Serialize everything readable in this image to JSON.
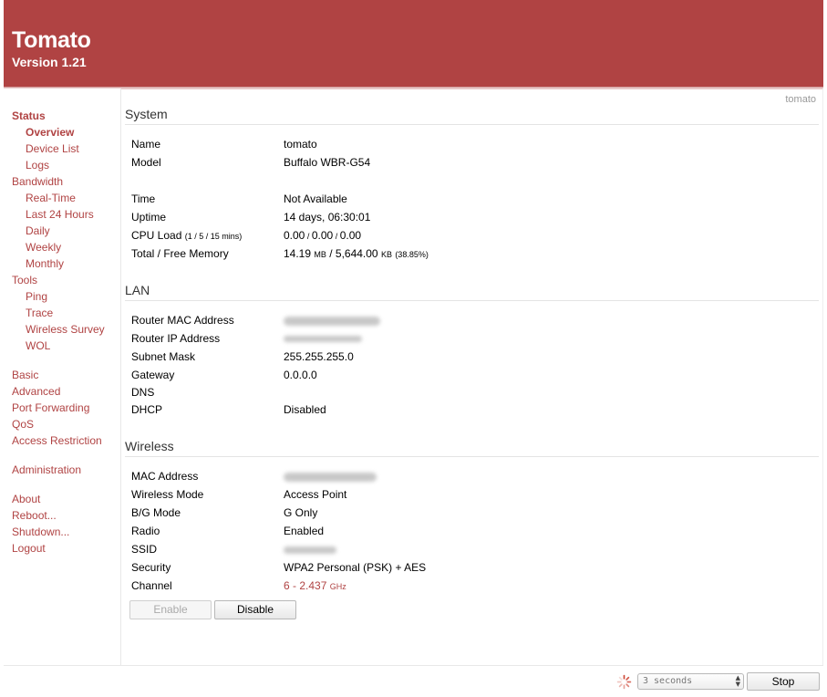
{
  "app": {
    "title": "Tomato",
    "version": "Version 1.21",
    "hostname": "tomato"
  },
  "nav": {
    "status": "Status",
    "overview": "Overview",
    "device_list": "Device List",
    "logs": "Logs",
    "bandwidth": "Bandwidth",
    "real_time": "Real-Time",
    "last24": "Last 24 Hours",
    "daily": "Daily",
    "weekly": "Weekly",
    "monthly": "Monthly",
    "tools": "Tools",
    "ping": "Ping",
    "trace": "Trace",
    "wireless_survey": "Wireless Survey",
    "wol": "WOL",
    "basic": "Basic",
    "advanced": "Advanced",
    "port_forwarding": "Port Forwarding",
    "qos": "QoS",
    "access_restriction": "Access Restriction",
    "administration": "Administration",
    "about": "About",
    "reboot": "Reboot...",
    "shutdown": "Shutdown...",
    "logout": "Logout"
  },
  "system": {
    "title": "System",
    "name_label": "Name",
    "name_value": "tomato",
    "model_label": "Model",
    "model_value": "Buffalo WBR-G54",
    "time_label": "Time",
    "time_value": "Not Available",
    "uptime_label": "Uptime",
    "uptime_value": "14 days, 06:30:01",
    "cpu_label": "CPU Load",
    "cpu_label_suffix": "(1 / 5 / 15 mins)",
    "cpu_1": "0.00",
    "cpu_5": "0.00",
    "cpu_15": "0.00",
    "cpu_sep": " / ",
    "mem_label": "Total / Free Memory",
    "mem_total": "14.19",
    "mem_total_unit": "MB",
    "mem_sep": " / ",
    "mem_free": "5,644.00",
    "mem_free_unit": "KB",
    "mem_pct": "(38.85%)"
  },
  "lan": {
    "title": "LAN",
    "mac_label": "Router MAC Address",
    "ip_label": "Router IP Address",
    "mask_label": "Subnet Mask",
    "mask_value": "255.255.255.0",
    "gateway_label": "Gateway",
    "gateway_value": "0.0.0.0",
    "dns_label": "DNS",
    "dns_value": "",
    "dhcp_label": "DHCP",
    "dhcp_value": "Disabled"
  },
  "wireless": {
    "title": "Wireless",
    "mac_label": "MAC Address",
    "mode_label": "Wireless Mode",
    "mode_value": "Access Point",
    "bg_label": "B/G Mode",
    "bg_value": "G Only",
    "radio_label": "Radio",
    "radio_value": "Enabled",
    "ssid_label": "SSID",
    "security_label": "Security",
    "security_value": "WPA2 Personal (PSK) + AES",
    "channel_label": "Channel",
    "channel_value": "6 - 2.437",
    "channel_unit": "GHz",
    "enable_label": "Enable",
    "disable_label": "Disable"
  },
  "footer": {
    "refresh_value": "3 seconds",
    "stop_label": "Stop"
  },
  "colors": {
    "brand": "#b04343",
    "link": "#b04343"
  }
}
